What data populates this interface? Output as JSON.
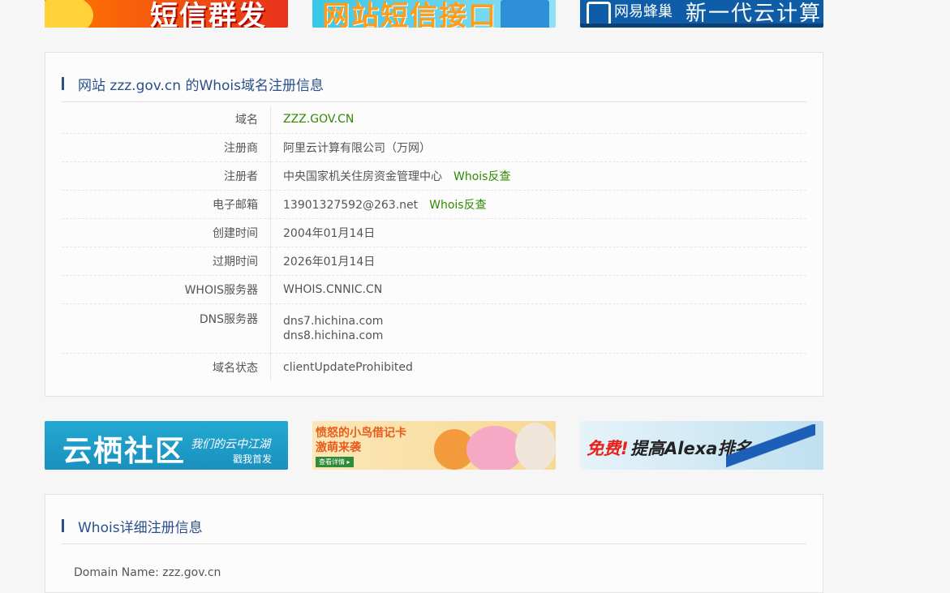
{
  "top_banners": [
    {
      "text": "短信群发"
    },
    {
      "text": "网站短信接口"
    },
    {
      "text1": "网易蜂巢",
      "text2": "新一代云计算"
    }
  ],
  "whois_panel": {
    "title": "网站 zzz.gov.cn 的Whois域名注册信息",
    "rows": [
      {
        "label": "域名",
        "value": "ZZZ.GOV.CN"
      },
      {
        "label": "注册商",
        "value": "阿里云计算有限公司（万网）"
      },
      {
        "label": "注册者",
        "value": "中央国家机关住房资金管理中心",
        "link": "Whois反查"
      },
      {
        "label": "电子邮箱",
        "value": "13901327592@263.net",
        "link": "Whois反查"
      },
      {
        "label": "创建时间",
        "value": "2004年01月14日"
      },
      {
        "label": "过期时间",
        "value": "2026年01月14日"
      },
      {
        "label": "WHOIS服务器",
        "value": "WHOIS.CNNIC.CN"
      },
      {
        "label": "DNS服务器",
        "values": [
          "dns7.hichina.com",
          "dns8.hichina.com"
        ]
      },
      {
        "label": "域名状态",
        "value": "clientUpdateProhibited"
      }
    ]
  },
  "middle_banners": [
    {
      "title": "云栖社区",
      "sub1": "我们的云中江湖",
      "sub2": "戳我首发"
    },
    {
      "line1": "愤怒的小鸟借记卡",
      "line2": "激萌来袭",
      "button": "查看详情 ▸"
    },
    {
      "text1": "免费!",
      "text2": "提高Alexa排名"
    }
  ],
  "detail_panel": {
    "title": "Whois详细注册信息",
    "first_line": "Domain Name: zzz.gov.cn"
  }
}
